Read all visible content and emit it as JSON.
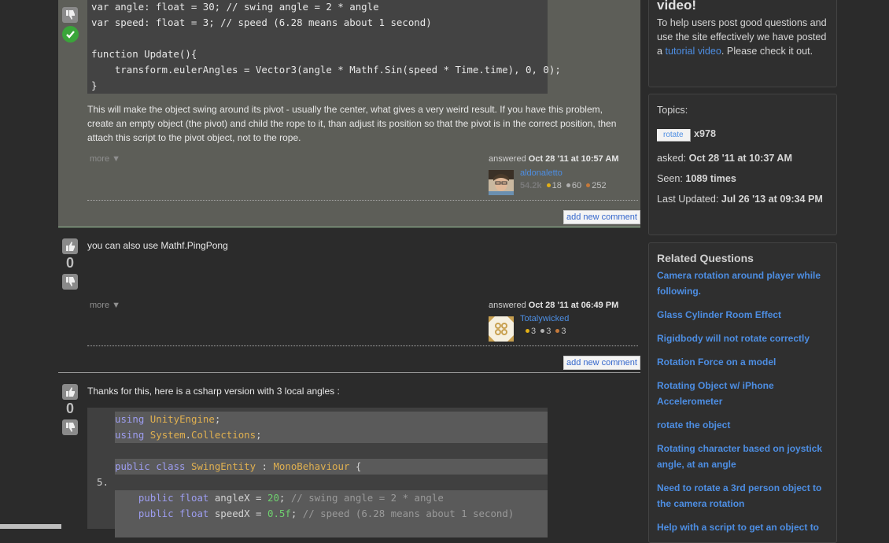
{
  "answers": [
    {
      "vote_count": "",
      "code_lines": [
        "var angle: float = 30; // swing angle = 2 * angle",
        "var speed: float = 3; // speed (6.28 means about 1 second)",
        "",
        "function Update(){",
        "    transform.eulerAngles = Vector3(angle * Mathf.Sin(speed * Time.time), 0, 0);",
        "}"
      ],
      "text": "This will make the object swing around its pivot - usually the center, what gives a very weird result. If you have this problem, create an empty object (the pivot) and child the rope to it, than adjust its position so that the pivot is in the correct position, then attach this script to the pivot object, not to the rope.",
      "more": "more ▼",
      "answered_label": "answered",
      "answered_date": "Oct 28 '11 at 10:57 AM",
      "user": "aldonaletto",
      "reputation": "54.2k",
      "gold": "18",
      "silver": "60",
      "bronze": "252",
      "add_comment": "add new comment"
    },
    {
      "vote_count": "0",
      "text": "you can also use Mathf.PingPong",
      "more": "more ▼",
      "answered_label": "answered",
      "answered_date": "Oct 28 '11 at 06:49 PM",
      "user": "Totalywicked",
      "gold": "3",
      "silver": "3",
      "bronze": "3",
      "add_comment": "add new comment"
    },
    {
      "vote_count": "0",
      "text": "Thanks for this, here is a csharp version with 3 local angles :",
      "line_number_5": "5."
    }
  ],
  "sidebar": {
    "video_heading": "video!",
    "video_text_1": "To help users post good questions and use the site effectively we have posted a",
    "video_link": "tutorial video",
    "video_text_2": ". Please check it out.",
    "topics_label": "Topics:",
    "tag": "rotate",
    "tag_count": "x978",
    "asked_label": "asked:",
    "asked_value": "Oct 28 '11 at 10:37 AM",
    "seen_label": "Seen:",
    "seen_value": "1089 times",
    "updated_label": "Last Updated:",
    "updated_value": "Jul 26 '13 at 09:34 PM",
    "related_title": "Related Questions",
    "related": [
      "Camera rotation around player while following.",
      "Glass Cylinder Room Effect",
      "Rigidbody will not rotate correctly",
      "Rotation Force on a model",
      "Rotating Object w/ iPhone Accelerometer",
      "rotate the object",
      "Rotating character based on joystick angle, at an angle",
      "Need to rotate a 3rd person object to the camera rotation",
      "Help with a script to get an object to"
    ]
  }
}
